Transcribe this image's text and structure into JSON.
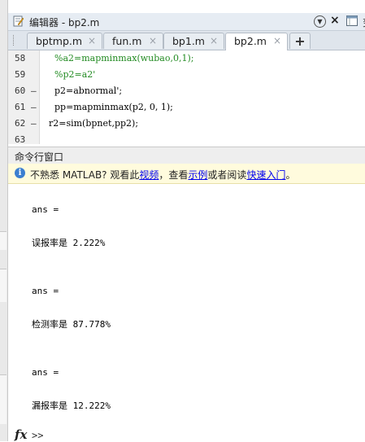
{
  "editor": {
    "title": "编辑器 - bp2.m",
    "right_label": "变"
  },
  "tabs": [
    {
      "label": "bptmp.m",
      "close": "×"
    },
    {
      "label": "fun.m",
      "close": "×"
    },
    {
      "label": "bp1.m",
      "close": "×"
    },
    {
      "label": "bp2.m",
      "close": "×",
      "active": true
    }
  ],
  "add_tab_label": "+",
  "code_lines": [
    {
      "num": "58",
      "marker": "",
      "text": "    %a2=mapminmax(wubao,0,1);",
      "kind": "comment"
    },
    {
      "num": "59",
      "marker": "",
      "text": "    %p2=a2'",
      "kind": "comment"
    },
    {
      "num": "60",
      "marker": "–",
      "text": "    p2=abnormal';",
      "kind": "normal"
    },
    {
      "num": "61",
      "marker": "–",
      "text": "    pp=mapminmax(p2, 0, 1);",
      "kind": "normal"
    },
    {
      "num": "62",
      "marker": "–",
      "text": "  r2=sim(bpnet,pp2);",
      "kind": "normal"
    },
    {
      "num": "63",
      "marker": "",
      "text": "",
      "kind": "normal"
    }
  ],
  "command_window": {
    "title": "命令行窗口",
    "info": {
      "prefix": "不熟悉 MATLAB? 观看此",
      "link1": "视频",
      "mid1": "，查看",
      "link2": "示例",
      "mid2": "或者阅读",
      "link3": "快速入门",
      "suffix": "。"
    },
    "output": [
      "ans =",
      "误报率是 2.222%",
      "ans =",
      "检测率是 87.778%",
      "ans =",
      "漏报率是 12.222%"
    ],
    "prompt_fx": "fx",
    "prompt": ">>"
  },
  "colors": {
    "comment": "#228b22",
    "link": "#0000ee",
    "info_bg": "#fffbdd",
    "tab_bar": "#dfe5ec"
  }
}
